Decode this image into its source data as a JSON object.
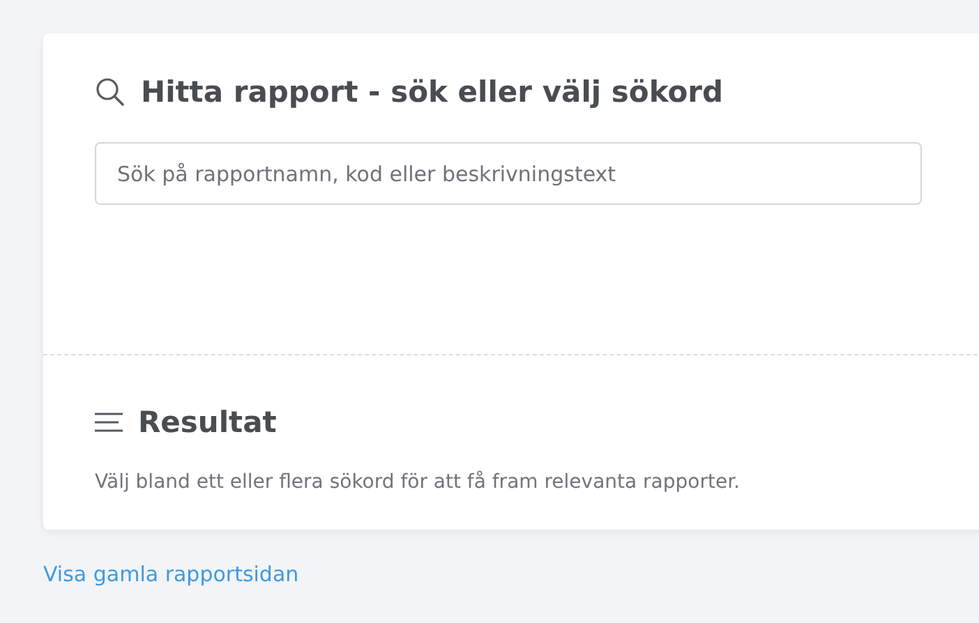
{
  "search_section": {
    "title": "Hitta rapport - sök eller välj sökord",
    "search": {
      "placeholder": "Sök på rapportnamn, kod eller beskrivningstext"
    }
  },
  "result_section": {
    "title": "Resultat",
    "message": "Välj bland ett eller flera sökord för att få fram relevanta rapporter."
  },
  "footer_link": "Visa gamla rapportsidan"
}
